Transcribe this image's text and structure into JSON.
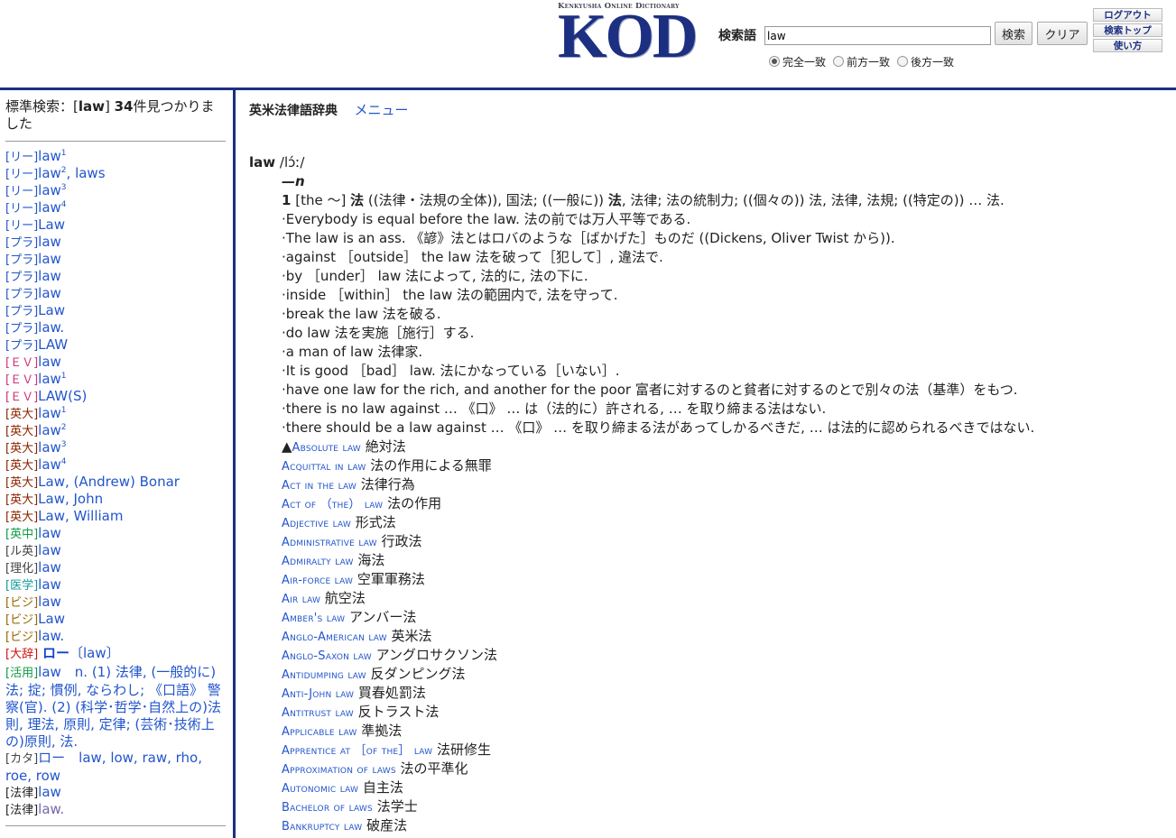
{
  "header": {
    "logo_small": "Kenkyusha Online Dictionary",
    "logo_big": "KOD",
    "search_label": "検索語",
    "search_value": "law",
    "search_button": "検索",
    "clear_button": "クリア",
    "logout": "ログアウト",
    "search_top": "検索トップ",
    "help": "使い方",
    "radios": [
      {
        "label": "完全一致",
        "selected": true
      },
      {
        "label": "前方一致",
        "selected": false
      },
      {
        "label": "後方一致",
        "selected": false
      }
    ]
  },
  "left": {
    "summary_prefix": "標準検索：[",
    "summary_term": "law",
    "summary_mid": "] ",
    "summary_count": "34",
    "summary_suffix": "件見つかりました",
    "items": [
      {
        "tag": "[リー]",
        "cls": "tg-ri",
        "text": "law",
        "sup": "1"
      },
      {
        "tag": "[リー]",
        "cls": "tg-ri",
        "text": "law",
        "sup": "2",
        "after": ", laws"
      },
      {
        "tag": "[リー]",
        "cls": "tg-ri",
        "text": "law",
        "sup": "3"
      },
      {
        "tag": "[リー]",
        "cls": "tg-ri",
        "text": "law",
        "sup": "4"
      },
      {
        "tag": "[リー]",
        "cls": "tg-ri",
        "text": "Law"
      },
      {
        "tag": "[プラ]",
        "cls": "tg-pr",
        "text": "law"
      },
      {
        "tag": "[プラ]",
        "cls": "tg-pr",
        "text": "law"
      },
      {
        "tag": "[プラ]",
        "cls": "tg-pr",
        "text": "law"
      },
      {
        "tag": "[プラ]",
        "cls": "tg-pr",
        "text": "law"
      },
      {
        "tag": "[プラ]",
        "cls": "tg-pr",
        "text": "Law"
      },
      {
        "tag": "[プラ]",
        "cls": "tg-pr",
        "text": "law."
      },
      {
        "tag": "[プラ]",
        "cls": "tg-pr",
        "text": "LAW"
      },
      {
        "tag": "[ＥＶ]",
        "cls": "tg-ev",
        "text": "law"
      },
      {
        "tag": "[ＥＶ]",
        "cls": "tg-ev",
        "text": "law",
        "sup": "1"
      },
      {
        "tag": "[ＥＶ]",
        "cls": "tg-ev",
        "text": "LAW(S)"
      },
      {
        "tag": "[英大]",
        "cls": "tg-ed",
        "text": "law",
        "sup": "1"
      },
      {
        "tag": "[英大]",
        "cls": "tg-ed",
        "text": "law",
        "sup": "2"
      },
      {
        "tag": "[英大]",
        "cls": "tg-ed",
        "text": "law",
        "sup": "3"
      },
      {
        "tag": "[英大]",
        "cls": "tg-ed",
        "text": "law",
        "sup": "4"
      },
      {
        "tag": "[英大]",
        "cls": "tg-ed",
        "text": "Law, (Andrew) Bonar"
      },
      {
        "tag": "[英大]",
        "cls": "tg-ed",
        "text": "Law, John"
      },
      {
        "tag": "[英大]",
        "cls": "tg-ed",
        "text": "Law, William"
      },
      {
        "tag": "[英中]",
        "cls": "tg-ec",
        "text": "law"
      },
      {
        "tag": "[ル英]",
        "cls": "tg-le",
        "text": "law"
      },
      {
        "tag": "[理化]",
        "cls": "tg-ri2",
        "text": "law"
      },
      {
        "tag": "[医学]",
        "cls": "tg-me",
        "text": "law"
      },
      {
        "tag": "[ビジ]",
        "cls": "tg-bz",
        "text": "law"
      },
      {
        "tag": "[ビジ]",
        "cls": "tg-bz",
        "text": "Law"
      },
      {
        "tag": "[ビジ]",
        "cls": "tg-bz",
        "text": "law."
      }
    ],
    "daijirin": {
      "tag": "[大辞]",
      "word": "ロー",
      "bracket": "〔law〕"
    },
    "katsuyou": {
      "tag": "[活用]",
      "text": "law　n. (1) 法律, (一般的に)法; 掟; 慣例, ならわし; 《口語》 警察(官). (2) (科学･哲学･自然上の)法則, 理法, 原則, 定律; (芸術･技術上の)原則, 法."
    },
    "katakana": {
      "tag": "[カタ]",
      "text": "ロー　law, low, raw, rho, roe, row"
    },
    "houritsu": [
      {
        "tag": "[法律]",
        "text": "law"
      },
      {
        "tag": "[法律]",
        "text": "law."
      }
    ]
  },
  "right": {
    "dict_name": "英米法律語辞典",
    "menu": "メニュー",
    "headword": "law",
    "pron": "/lɔ́ː/",
    "pos": "—n",
    "sense": {
      "num": "1",
      "pre": "[the 〜] ",
      "bold1": "法",
      "mid1": " ((法律・法規の全体)), 国法; ((一般に)) ",
      "bold2": "法",
      "rest": ", 法律; 法の統制力; ((個々の)) 法, 法律, 法規; ((特定の)) … 法."
    },
    "examples": [
      "·Everybody is equal before the law. 法の前では万人平等である.",
      "·The law is an ass. 《諺》法とはロバのような［ばかげた］ものだ ((Dickens, Oliver Twist から)).",
      "·against ［outside］ the law 法を破って［犯して］, 違法で.",
      "·by ［under］ law 法によって, 法的に, 法の下に.",
      "·inside ［within］ the law 法の範囲内で, 法を守って.",
      "·break the law 法を破る.",
      "·do law 法を実施［施行］する.",
      "·a man of law 法律家.",
      "·It is good ［bad］ law. 法にかなっている［いない］.",
      "·have one law for the rich, and another for the poor 富者に対するのと貧者に対するのとで別々の法（基準）をもつ.",
      "·there is no law against … 《口》 … は（法的に）許される, … を取り締まる法はない.",
      "·there should be a law against … 《口》 … を取り締まる法があってしかるべきだ, … は法的に認められるべきではない."
    ],
    "compounds_marker": "▲",
    "compounds": [
      {
        "term": "Absolute law",
        "jp": "絶対法"
      },
      {
        "term": "Acquittal in law",
        "jp": "法の作用による無罪"
      },
      {
        "term": "Act in the law",
        "jp": "法律行為"
      },
      {
        "term": "Act of （the） law",
        "jp": "法の作用"
      },
      {
        "term": "Adjective law",
        "jp": "形式法"
      },
      {
        "term": "Administrative law",
        "jp": "行政法"
      },
      {
        "term": "Admiralty law",
        "jp": "海法"
      },
      {
        "term": "Air-force law",
        "jp": "空軍軍務法"
      },
      {
        "term": "Air law",
        "jp": "航空法"
      },
      {
        "term": "Amber's law",
        "jp": "アンバー法"
      },
      {
        "term": "Anglo-American law",
        "jp": "英米法"
      },
      {
        "term": "Anglo-Saxon law",
        "jp": "アングロサクソン法"
      },
      {
        "term": "Antidumping law",
        "jp": "反ダンピング法"
      },
      {
        "term": "Anti-John law",
        "jp": "買春処罰法"
      },
      {
        "term": "Antitrust law",
        "jp": "反トラスト法"
      },
      {
        "term": "Applicable law",
        "jp": "準拠法"
      },
      {
        "term": "Apprentice at ［of the］ law",
        "jp": "法研修生"
      },
      {
        "term": "Approximation of laws",
        "jp": "法の平準化"
      },
      {
        "term": "Autonomic law",
        "jp": "自主法"
      },
      {
        "term": "Bachelor of laws",
        "jp": "法学士"
      },
      {
        "term": "Bankruptcy law",
        "jp": "破産法"
      }
    ]
  }
}
